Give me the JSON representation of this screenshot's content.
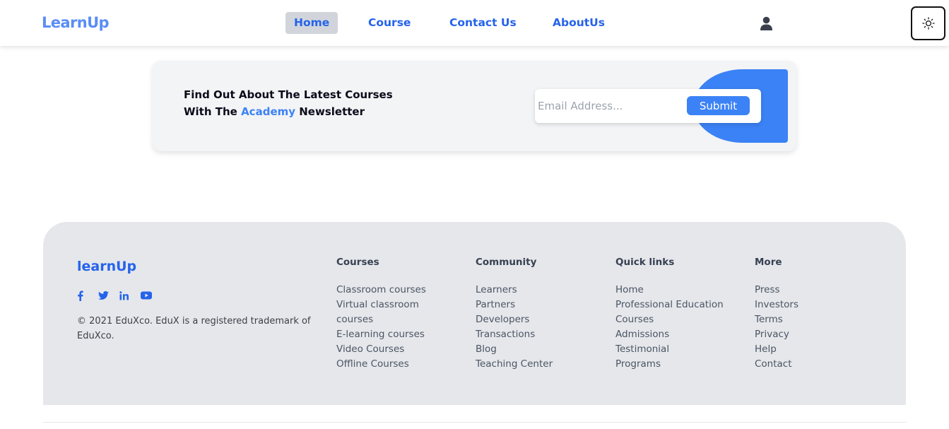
{
  "header": {
    "logo": "LearnUp",
    "nav": [
      {
        "label": "Home",
        "active": true
      },
      {
        "label": "Course",
        "active": false
      },
      {
        "label": "Contact Us",
        "active": false
      },
      {
        "label": "AboutUs",
        "active": false
      }
    ],
    "icons": [
      "user-icon",
      "sun-icon"
    ]
  },
  "newsletter": {
    "line1": "Find Out About The Latest Courses",
    "line2_prefix": "With The ",
    "line2_highlight": "Academy",
    "line2_suffix": " Newsletter",
    "email_placeholder": "Email Address...",
    "email_value": "",
    "submit_label": "Submit"
  },
  "footer": {
    "brand": "learnUp",
    "socials": [
      "facebook-icon",
      "twitter-icon",
      "linkedin-icon",
      "youtube-icon"
    ],
    "copyright": "© 2021 EduXco. EduX is a registered trademark of EduXco.",
    "columns": [
      {
        "title": "Courses",
        "links": [
          "Classroom courses",
          "Virtual classroom courses",
          "E-learning courses",
          "Video Courses",
          "Offline Courses"
        ]
      },
      {
        "title": "Community",
        "links": [
          "Learners",
          "Partners",
          "Developers",
          "Transactions",
          "Blog",
          "Teaching Center"
        ]
      },
      {
        "title": "Quick links",
        "links": [
          "Home",
          "Professional Education",
          "Courses",
          "Admissions",
          "Testimonial",
          "Programs"
        ]
      },
      {
        "title": "More",
        "links": [
          "Press",
          "Investors",
          "Terms",
          "Privacy",
          "Help",
          "Contact"
        ]
      }
    ]
  },
  "colors": {
    "accent": "#2563eb",
    "accent_light": "#3b82f6",
    "footer_bg": "#e5e7eb",
    "newsletter_bg": "#f3f4f6",
    "active_nav_bg": "#d1d5db"
  }
}
